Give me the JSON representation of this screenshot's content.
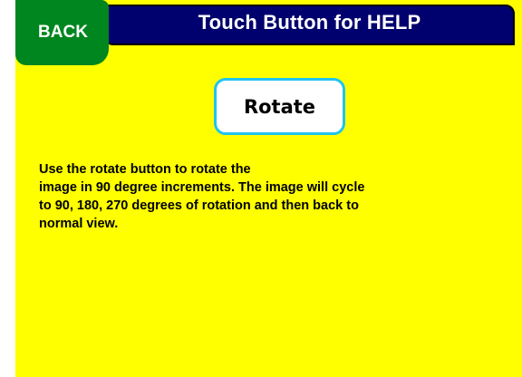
{
  "header": {
    "title": "Touch Button for HELP"
  },
  "back_button": {
    "label": "BACK"
  },
  "rotate_button": {
    "label": "Rotate"
  },
  "help": {
    "text": "Use the rotate button to rotate the\nimage in 90 degree increments.  The image will cycle\nto 90, 180, 270 degrees of rotation and then back to\nnormal view."
  },
  "colors": {
    "panel_background": "#ffff00",
    "header_background": "#00006e",
    "back_button_background": "#00861e",
    "rotate_button_border": "#1fc4f0"
  }
}
